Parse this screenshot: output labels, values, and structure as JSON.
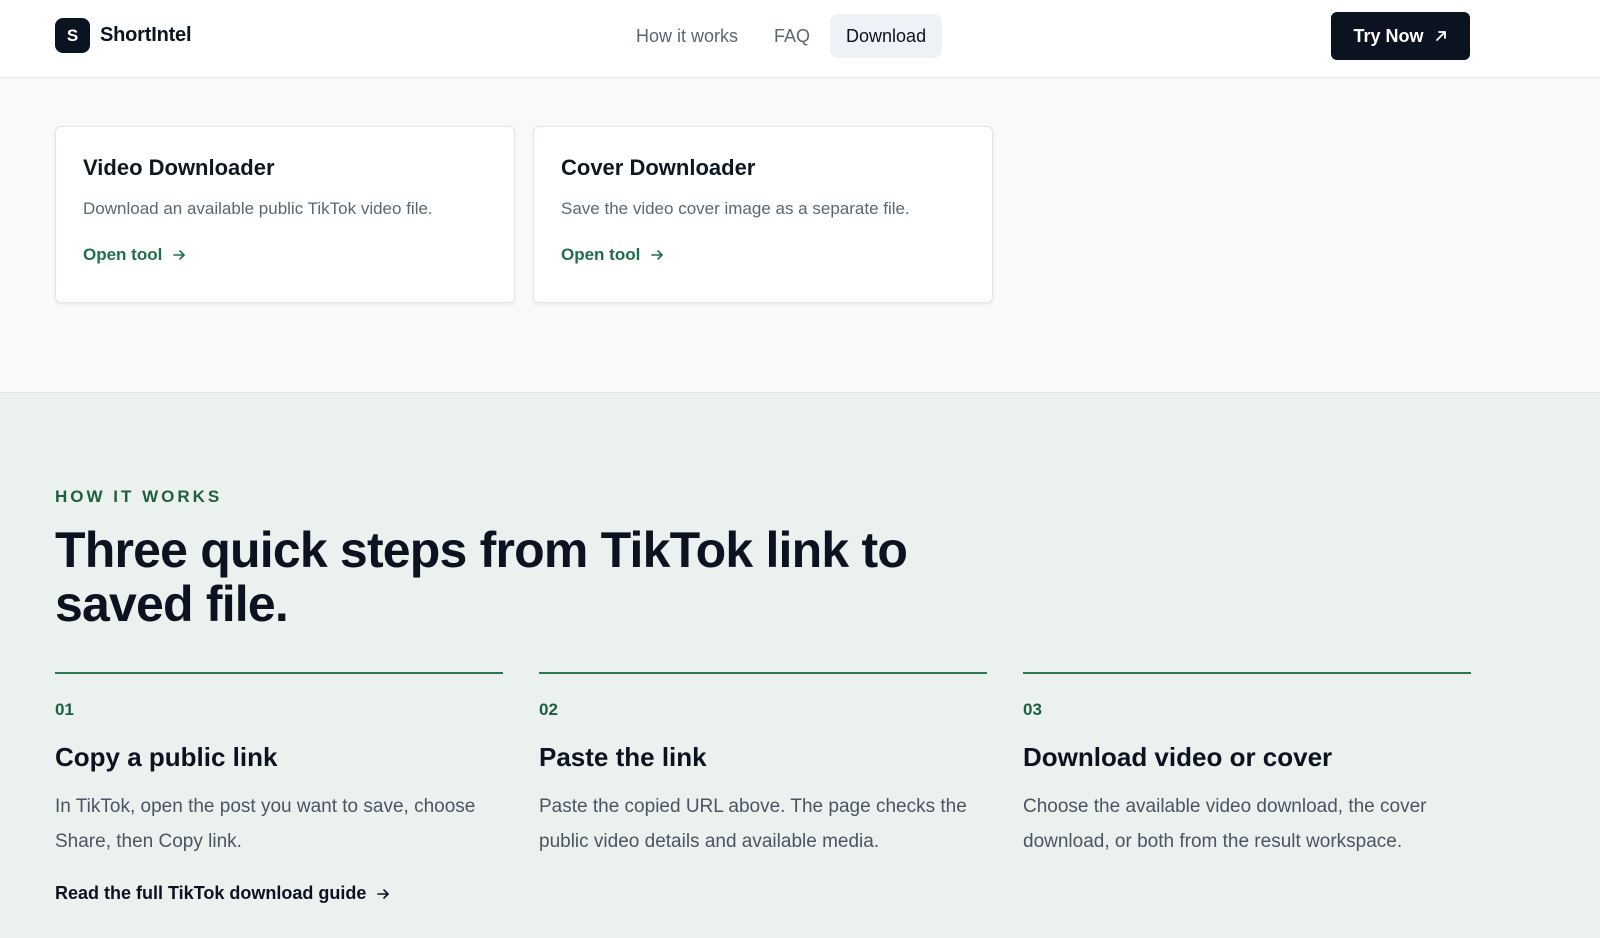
{
  "header": {
    "brand_logo_letter": "S",
    "brand_name": "ShortIntel",
    "nav": [
      {
        "label": "How it works",
        "active": false
      },
      {
        "label": "FAQ",
        "active": false
      },
      {
        "label": "Download",
        "active": true
      }
    ],
    "cta_label": "Try Now",
    "cta_icon": "arrow-up-right-icon"
  },
  "tools": [
    {
      "title": "Video Downloader",
      "description": "Download an available public TikTok video file.",
      "link_label": "Open tool",
      "link_icon": "arrow-right-icon"
    },
    {
      "title": "Cover Downloader",
      "description": "Save the video cover image as a separate file.",
      "link_label": "Open tool",
      "link_icon": "arrow-right-icon"
    }
  ],
  "how_it_works": {
    "eyebrow": "HOW IT WORKS",
    "headline": "Three quick steps from TikTok link to saved file.",
    "steps": [
      {
        "number": "01",
        "title": "Copy a public link",
        "description": "In TikTok, open the post you want to save, choose Share, then Copy link."
      },
      {
        "number": "02",
        "title": "Paste the link",
        "description": "Paste the copied URL above. The page checks the public video details and available media."
      },
      {
        "number": "03",
        "title": "Download video or cover",
        "description": "Choose the available video download, the cover download, or both from the result workspace."
      }
    ],
    "guide_link_label": "Read the full TikTok download guide",
    "guide_link_icon": "arrow-right-icon"
  },
  "colors": {
    "brand_dark": "#0b1320",
    "accent_green": "#1f7048",
    "how_bg": "#ebf1ef",
    "page_bg": "#f8f9fb"
  }
}
